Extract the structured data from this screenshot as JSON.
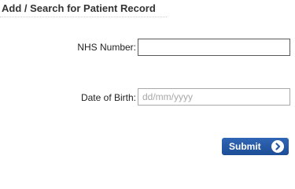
{
  "form": {
    "title": "Add / Search for Patient Record",
    "nhs_number": {
      "label": "NHS Number:",
      "value": "",
      "placeholder": ""
    },
    "date_of_birth": {
      "label": "Date of Birth:",
      "value": "",
      "placeholder": "dd/mm/yyyy"
    },
    "submit_label": "Submit",
    "submit_icon": "chevron-right-circle-icon",
    "colors": {
      "button": "#2458a6",
      "title": "#333333"
    }
  }
}
